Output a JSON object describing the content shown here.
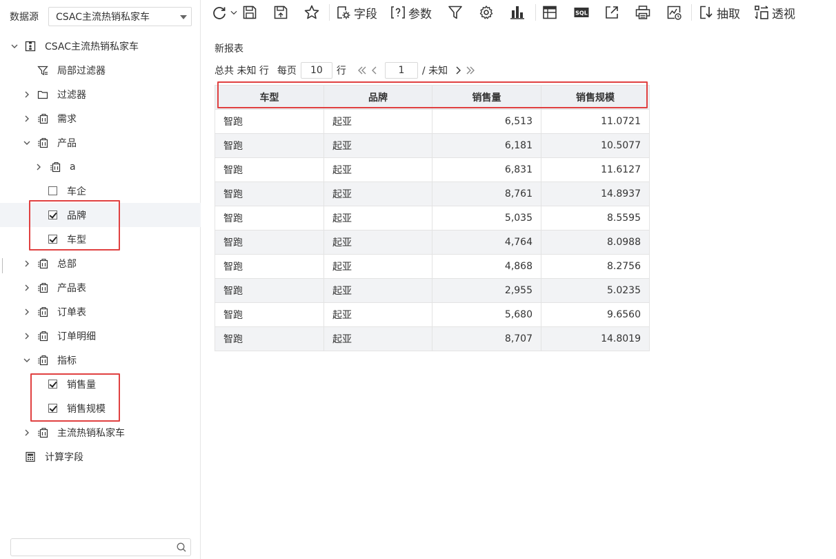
{
  "datasource": {
    "label": "数据源",
    "selected": "CSAC主流热销私家车"
  },
  "tree": {
    "root": "CSAC主流热销私家车",
    "local_filter": "局部过滤器",
    "filter": "过滤器",
    "demand": "需求",
    "product": "产品",
    "product_a": "a",
    "product_company": "车企",
    "product_brand": "品牌",
    "product_model": "车型",
    "headquarters": "总部",
    "product_table": "产品表",
    "order_table": "订单表",
    "order_detail": "订单明细",
    "metrics": "指标",
    "metric_sales_volume": "销售量",
    "metric_sales_scale": "销售规模",
    "mainstream": "主流热销私家车",
    "calc_field": "计算字段"
  },
  "search": {
    "placeholder": ""
  },
  "toolbar": {
    "fields_label": "字段",
    "params_label": "参数",
    "extract_label": "抽取",
    "pivot_label": "透视"
  },
  "report": {
    "title": "新报表",
    "pager": {
      "total_label": "总共 未知 行",
      "per_page_label": "每页",
      "page_size": "10",
      "rows_label": "行",
      "current_page": "1",
      "total_pages": "/ 未知"
    },
    "columns": [
      "车型",
      "品牌",
      "销售量",
      "销售规模"
    ],
    "rows": [
      [
        "智跑",
        "起亚",
        "6,513",
        "11.0721"
      ],
      [
        "智跑",
        "起亚",
        "6,181",
        "10.5077"
      ],
      [
        "智跑",
        "起亚",
        "6,831",
        "11.6127"
      ],
      [
        "智跑",
        "起亚",
        "8,761",
        "14.8937"
      ],
      [
        "智跑",
        "起亚",
        "5,035",
        "8.5595"
      ],
      [
        "智跑",
        "起亚",
        "4,764",
        "8.0988"
      ],
      [
        "智跑",
        "起亚",
        "4,868",
        "8.2756"
      ],
      [
        "智跑",
        "起亚",
        "2,955",
        "5.0235"
      ],
      [
        "智跑",
        "起亚",
        "5,680",
        "9.6560"
      ],
      [
        "智跑",
        "起亚",
        "8,707",
        "14.8019"
      ]
    ]
  }
}
